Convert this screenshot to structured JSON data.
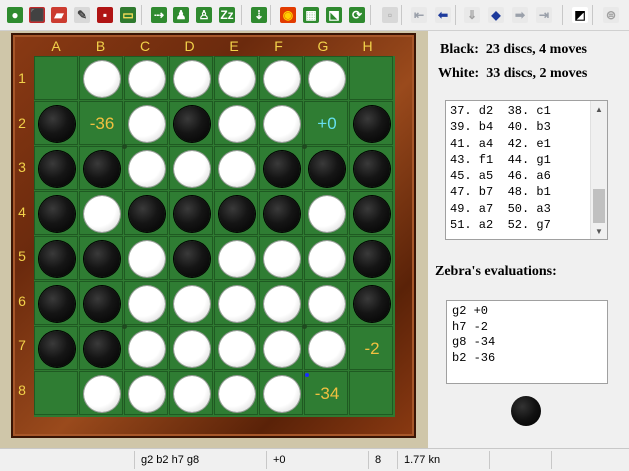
{
  "toolbar": [
    {
      "name": "new-game-icon",
      "glyph": "●",
      "bg": "#2e8b2e",
      "fg": "#ffffff"
    },
    {
      "name": "new-game-red-icon",
      "glyph": "⬛",
      "bg": "#c0282a",
      "fg": "#ffffff"
    },
    {
      "name": "setup-board-icon",
      "glyph": "▰",
      "bg": "#cc3b2f",
      "fg": "#ffffff"
    },
    {
      "name": "edit-icon",
      "glyph": "✎",
      "bg": "#d9d9d9",
      "fg": "#444444"
    },
    {
      "name": "save-icon",
      "glyph": "▪",
      "bg": "#b01515",
      "fg": "#ffffff"
    },
    {
      "name": "open-folder-icon",
      "glyph": "▭",
      "bg": "#2f7a2f",
      "fg": "#ffe25a"
    },
    {
      "name": "play-icon",
      "glyph": "⇢",
      "bg": "#2f8a2f",
      "fg": "#ffffff"
    },
    {
      "name": "engine-black-icon",
      "glyph": "♟",
      "bg": "#2f8a2f",
      "fg": "#ffffff"
    },
    {
      "name": "engine-white-icon",
      "glyph": "♙",
      "bg": "#2f8a2f",
      "fg": "#ffffff"
    },
    {
      "name": "sleep-icon",
      "glyph": "Zz",
      "bg": "#2f8a2f",
      "fg": "#ffffff"
    },
    {
      "name": "hint-icon",
      "glyph": "⇣",
      "bg": "#2f8a2f",
      "fg": "#ffffff"
    },
    {
      "name": "stop-icon",
      "glyph": "◉",
      "bg": "#e23b00",
      "fg": "#ffd000"
    },
    {
      "name": "board-icon",
      "glyph": "▦",
      "bg": "#2f8a2f",
      "fg": "#ffffff"
    },
    {
      "name": "flip-board-icon",
      "glyph": "⬔",
      "bg": "#2f8a2f",
      "fg": "#ffffff"
    },
    {
      "name": "rotate-icon",
      "glyph": "⟳",
      "bg": "#2f8a2f",
      "fg": "#ffffff"
    },
    {
      "name": "disabled-1-icon",
      "glyph": "▫",
      "bg": "#d8d8d8",
      "fg": "#a0a0a0"
    },
    {
      "name": "first-move-icon",
      "glyph": "⇤",
      "bg": "#e9e9e9",
      "fg": "#9aa0aa"
    },
    {
      "name": "back-icon",
      "glyph": "⬅",
      "bg": "#e9e9e9",
      "fg": "#1d3a9c"
    },
    {
      "name": "undo-icon",
      "glyph": "⇓",
      "bg": "#e9e9e9",
      "fg": "#a0a0a0"
    },
    {
      "name": "lightbulb-icon",
      "glyph": "◆",
      "bg": "#e9e9e9",
      "fg": "#1d3a9c"
    },
    {
      "name": "forward-icon",
      "glyph": "➡",
      "bg": "#e9e9e9",
      "fg": "#9aa0aa"
    },
    {
      "name": "last-move-icon",
      "glyph": "⇥",
      "bg": "#e9e9e9",
      "fg": "#9aa0aa"
    },
    {
      "name": "contrast-icon",
      "glyph": "◩",
      "bg": "#ffffff",
      "fg": "#000000"
    },
    {
      "name": "options-icon",
      "glyph": "⊜",
      "bg": "#e9e9e9",
      "fg": "#a0a0a0"
    }
  ],
  "board": {
    "col_labels": [
      "A",
      "B",
      "C",
      "D",
      "E",
      "F",
      "G",
      "H"
    ],
    "row_labels": [
      "1",
      "2",
      "3",
      "4",
      "5",
      "6",
      "7",
      "8"
    ],
    "rows": [
      [
        "",
        "W",
        "W",
        "W",
        "W",
        "W",
        "W",
        ""
      ],
      [
        "B",
        "",
        "W",
        "B",
        "W",
        "W",
        "",
        "B"
      ],
      [
        "B",
        "B",
        "W",
        "W",
        "W",
        "B",
        "B",
        "B"
      ],
      [
        "B",
        "W",
        "B",
        "B",
        "B",
        "B",
        "W",
        "B"
      ],
      [
        "B",
        "B",
        "W",
        "B",
        "W",
        "W",
        "W",
        "B"
      ],
      [
        "B",
        "B",
        "W",
        "W",
        "W",
        "W",
        "W",
        "B"
      ],
      [
        "B",
        "B",
        "W",
        "W",
        "W",
        "W",
        "W",
        ""
      ],
      [
        "",
        "W",
        "W",
        "W",
        "W",
        "W",
        "",
        ""
      ]
    ],
    "evaluations": [
      {
        "row": 1,
        "col": 1,
        "text": "-36",
        "color": "#f0c040"
      },
      {
        "row": 1,
        "col": 6,
        "text": "+0",
        "color": "#66e0f0"
      },
      {
        "row": 6,
        "col": 7,
        "text": "-2",
        "color": "#f0c040"
      },
      {
        "row": 7,
        "col": 6,
        "text": "-34",
        "color": "#f0c040"
      }
    ],
    "colors": {
      "felt": "#2f7d33",
      "grid": "#1f5a22",
      "label": "#f2d24a"
    }
  },
  "score": {
    "black": "Black:  23 discs, 4 moves",
    "white": "White:  33 discs, 2 moves"
  },
  "move_list": [
    "37. d2  38. c1",
    "39. b4  40. b3",
    "41. a4  42. e1",
    "43. f1  44. g1",
    "45. a5  46. a6",
    "47. b7  48. b1",
    "49. a7  50. a3",
    "51. a2  52. g7"
  ],
  "zebra": {
    "title": "Zebra's evaluations:",
    "items": [
      "g2 +0",
      "h7 -2",
      "g8 -34",
      "b2 -36"
    ]
  },
  "turn": "black",
  "status_bar": {
    "moves": "g2 b2 h7 g8",
    "eval": "+0",
    "depth": "8",
    "speed": "1.77 kn"
  }
}
